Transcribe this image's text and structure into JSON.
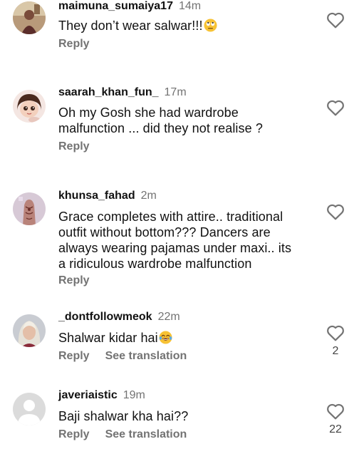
{
  "comments": [
    {
      "username": "maimuna_sumaiya17",
      "time": "14m",
      "text": "They don’t wear salwar!!!",
      "emoji": "rolling-eyes-emoji",
      "reply_label": "Reply",
      "likes": ""
    },
    {
      "username": "saarah_khan_fun_",
      "time": "17m",
      "text_lines": [
        "Oh my Gosh she had wardrobe",
        "malfunction ... did they not realise ?"
      ],
      "reply_label": "Reply",
      "likes": ""
    },
    {
      "username": "khunsa_fahad",
      "time": "2m",
      "text_lines": [
        "Grace completes with attire.. traditional",
        "outfit without bottom??? Dancers are",
        "always wearing pajamas under maxi.. its",
        "a ridiculous  wardrobe  malfunction"
      ],
      "reply_label": "Reply",
      "likes": ""
    },
    {
      "username": "_dontfollowmeok",
      "time": "22m",
      "text": "Shalwar kidar hai",
      "emoji": "tears-of-joy-emoji",
      "reply_label": "Reply",
      "translate_label": "See translation",
      "likes": "2"
    },
    {
      "username": "javeriaistic",
      "time": "19m",
      "text": "Baji shalwar kha hai??",
      "reply_label": "Reply",
      "translate_label": "See translation",
      "likes": "22"
    }
  ],
  "colors": {
    "text": "#111111",
    "muted": "#737373"
  }
}
